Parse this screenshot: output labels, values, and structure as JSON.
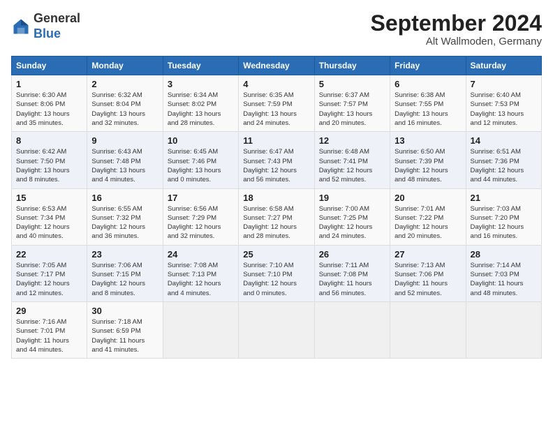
{
  "header": {
    "logo_general": "General",
    "logo_blue": "Blue",
    "month_title": "September 2024",
    "location": "Alt Wallmoden, Germany"
  },
  "columns": [
    "Sunday",
    "Monday",
    "Tuesday",
    "Wednesday",
    "Thursday",
    "Friday",
    "Saturday"
  ],
  "rows": [
    [
      {
        "day": "1",
        "info": "Sunrise: 6:30 AM\nSunset: 8:06 PM\nDaylight: 13 hours\nand 35 minutes."
      },
      {
        "day": "2",
        "info": "Sunrise: 6:32 AM\nSunset: 8:04 PM\nDaylight: 13 hours\nand 32 minutes."
      },
      {
        "day": "3",
        "info": "Sunrise: 6:34 AM\nSunset: 8:02 PM\nDaylight: 13 hours\nand 28 minutes."
      },
      {
        "day": "4",
        "info": "Sunrise: 6:35 AM\nSunset: 7:59 PM\nDaylight: 13 hours\nand 24 minutes."
      },
      {
        "day": "5",
        "info": "Sunrise: 6:37 AM\nSunset: 7:57 PM\nDaylight: 13 hours\nand 20 minutes."
      },
      {
        "day": "6",
        "info": "Sunrise: 6:38 AM\nSunset: 7:55 PM\nDaylight: 13 hours\nand 16 minutes."
      },
      {
        "day": "7",
        "info": "Sunrise: 6:40 AM\nSunset: 7:53 PM\nDaylight: 13 hours\nand 12 minutes."
      }
    ],
    [
      {
        "day": "8",
        "info": "Sunrise: 6:42 AM\nSunset: 7:50 PM\nDaylight: 13 hours\nand 8 minutes."
      },
      {
        "day": "9",
        "info": "Sunrise: 6:43 AM\nSunset: 7:48 PM\nDaylight: 13 hours\nand 4 minutes."
      },
      {
        "day": "10",
        "info": "Sunrise: 6:45 AM\nSunset: 7:46 PM\nDaylight: 13 hours\nand 0 minutes."
      },
      {
        "day": "11",
        "info": "Sunrise: 6:47 AM\nSunset: 7:43 PM\nDaylight: 12 hours\nand 56 minutes."
      },
      {
        "day": "12",
        "info": "Sunrise: 6:48 AM\nSunset: 7:41 PM\nDaylight: 12 hours\nand 52 minutes."
      },
      {
        "day": "13",
        "info": "Sunrise: 6:50 AM\nSunset: 7:39 PM\nDaylight: 12 hours\nand 48 minutes."
      },
      {
        "day": "14",
        "info": "Sunrise: 6:51 AM\nSunset: 7:36 PM\nDaylight: 12 hours\nand 44 minutes."
      }
    ],
    [
      {
        "day": "15",
        "info": "Sunrise: 6:53 AM\nSunset: 7:34 PM\nDaylight: 12 hours\nand 40 minutes."
      },
      {
        "day": "16",
        "info": "Sunrise: 6:55 AM\nSunset: 7:32 PM\nDaylight: 12 hours\nand 36 minutes."
      },
      {
        "day": "17",
        "info": "Sunrise: 6:56 AM\nSunset: 7:29 PM\nDaylight: 12 hours\nand 32 minutes."
      },
      {
        "day": "18",
        "info": "Sunrise: 6:58 AM\nSunset: 7:27 PM\nDaylight: 12 hours\nand 28 minutes."
      },
      {
        "day": "19",
        "info": "Sunrise: 7:00 AM\nSunset: 7:25 PM\nDaylight: 12 hours\nand 24 minutes."
      },
      {
        "day": "20",
        "info": "Sunrise: 7:01 AM\nSunset: 7:22 PM\nDaylight: 12 hours\nand 20 minutes."
      },
      {
        "day": "21",
        "info": "Sunrise: 7:03 AM\nSunset: 7:20 PM\nDaylight: 12 hours\nand 16 minutes."
      }
    ],
    [
      {
        "day": "22",
        "info": "Sunrise: 7:05 AM\nSunset: 7:17 PM\nDaylight: 12 hours\nand 12 minutes."
      },
      {
        "day": "23",
        "info": "Sunrise: 7:06 AM\nSunset: 7:15 PM\nDaylight: 12 hours\nand 8 minutes."
      },
      {
        "day": "24",
        "info": "Sunrise: 7:08 AM\nSunset: 7:13 PM\nDaylight: 12 hours\nand 4 minutes."
      },
      {
        "day": "25",
        "info": "Sunrise: 7:10 AM\nSunset: 7:10 PM\nDaylight: 12 hours\nand 0 minutes."
      },
      {
        "day": "26",
        "info": "Sunrise: 7:11 AM\nSunset: 7:08 PM\nDaylight: 11 hours\nand 56 minutes."
      },
      {
        "day": "27",
        "info": "Sunrise: 7:13 AM\nSunset: 7:06 PM\nDaylight: 11 hours\nand 52 minutes."
      },
      {
        "day": "28",
        "info": "Sunrise: 7:14 AM\nSunset: 7:03 PM\nDaylight: 11 hours\nand 48 minutes."
      }
    ],
    [
      {
        "day": "29",
        "info": "Sunrise: 7:16 AM\nSunset: 7:01 PM\nDaylight: 11 hours\nand 44 minutes."
      },
      {
        "day": "30",
        "info": "Sunrise: 7:18 AM\nSunset: 6:59 PM\nDaylight: 11 hours\nand 41 minutes."
      },
      {
        "day": "",
        "info": ""
      },
      {
        "day": "",
        "info": ""
      },
      {
        "day": "",
        "info": ""
      },
      {
        "day": "",
        "info": ""
      },
      {
        "day": "",
        "info": ""
      }
    ]
  ]
}
